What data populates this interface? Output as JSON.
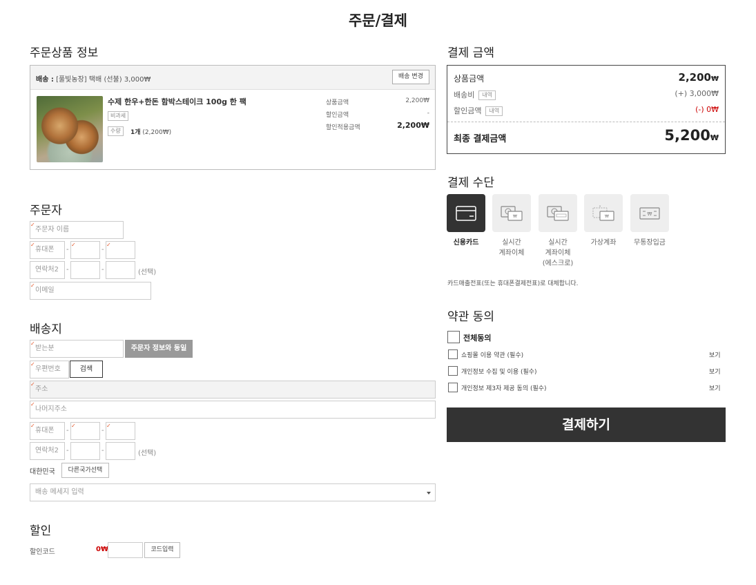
{
  "page_title": "주문/결제",
  "order_items": {
    "title": "주문상품 정보",
    "shipping_label": "배송 :",
    "shipping_info": "[풀빛농장] 택배 (선불) 3,000₩",
    "change_shipping_button": "배송 변경",
    "product_name": "수제 한우+한돈 함박스테이크 100g 한 팩",
    "tax_tag": "비과세",
    "qty_tag": "수량",
    "qty_value": "1개",
    "qty_price": "(2,200₩)",
    "price_rows": [
      {
        "label": "상품금액",
        "value": "2,200₩"
      },
      {
        "label": "할인금액",
        "value": "-"
      },
      {
        "label": "할인적용금액",
        "value": "2,200₩"
      }
    ]
  },
  "orderer": {
    "title": "주문자",
    "name_placeholder": "주문자 이름",
    "phone_placeholder": "휴대폰",
    "phone2_placeholder": "연락처2",
    "optional_label": "(선택)",
    "email_placeholder": "이메일",
    "dash": "-"
  },
  "shipping": {
    "title": "배송지",
    "receiver_placeholder": "받는분",
    "same_as_orderer_button": "주문자 정보와 동일",
    "zip_placeholder": "우편번호",
    "search_button": "검색",
    "address_placeholder": "주소",
    "address_detail_placeholder": "나머지주소",
    "phone_placeholder": "휴대폰",
    "phone2_placeholder": "연락처2",
    "optional_label": "(선택)",
    "country": "대한민국",
    "other_country_button": "다른국가선택",
    "message_select": "배송 메세지 입력"
  },
  "discount": {
    "title": "할인",
    "code_label": "할인코드",
    "amount": "0₩",
    "code_input_button": "코드입력"
  },
  "payment_summary": {
    "title": "결제 금액",
    "product_amount_label": "상품금액",
    "product_amount_number": "2,200",
    "shipping_label": "배송비",
    "shipping_tag": "내역",
    "shipping_value": "(+) 3,000₩",
    "discount_label": "할인금액",
    "discount_tag": "내역",
    "discount_value": "(-) 0₩",
    "final_label": "최종 결제금액",
    "final_number": "5,200",
    "currency": "₩"
  },
  "payment_methods": {
    "title": "결제 수단",
    "items": [
      {
        "label": "신용카드",
        "icon": "credit-card-icon"
      },
      {
        "label": "실시간\n계좌이체",
        "icon": "bank-transfer-icon"
      },
      {
        "label": "실시간\n계좌이체\n(에스크로)",
        "icon": "escrow-transfer-icon"
      },
      {
        "label": "가상계좌",
        "icon": "virtual-account-icon"
      },
      {
        "label": "무통장입금",
        "icon": "deposit-icon"
      }
    ],
    "note": "카드매출전표(또는 휴대폰결제전표)로 대체합니다."
  },
  "terms": {
    "title": "약관 동의",
    "agree_all": "전체동의",
    "items": [
      {
        "label": "쇼핑몰 이용 약관 (필수)",
        "view": "보기"
      },
      {
        "label": "개인정보 수집 및 이용 (필수)",
        "view": "보기"
      },
      {
        "label": "개인정보 제3자 제공 동의 (필수)",
        "view": "보기"
      }
    ]
  },
  "pay_button": "결제하기",
  "colors": {
    "accent_dark": "#333333",
    "discount_red": "#cc0000",
    "required_mark": "#e2572b"
  }
}
